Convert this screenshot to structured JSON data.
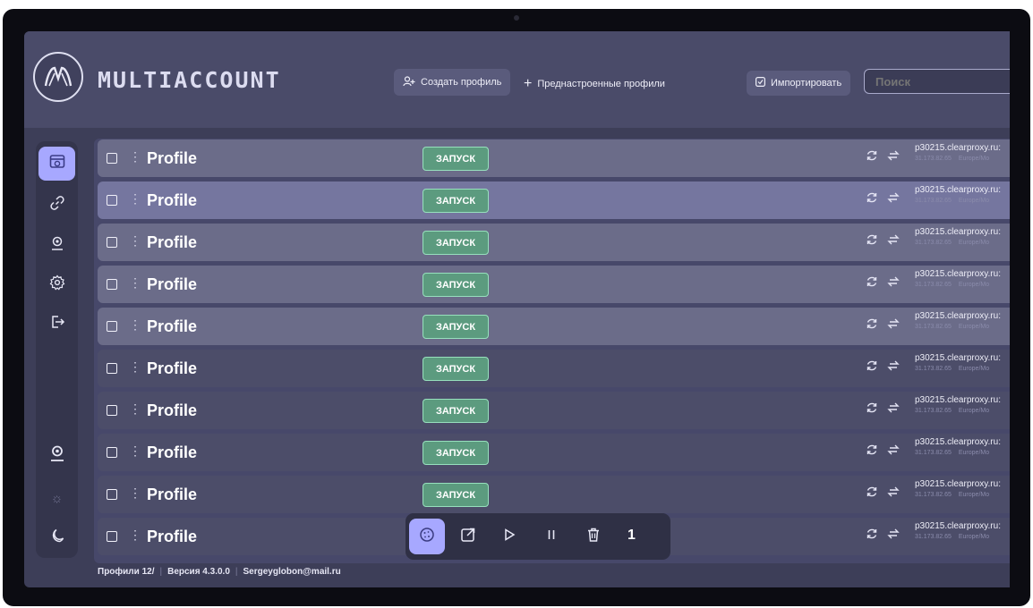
{
  "header": {
    "brand": "MULTIACCOUNT",
    "create_profile": "Создать профиль",
    "preset_profiles": "Преднастроенные профили",
    "import": "Импортировать",
    "search_placeholder": "Поиск"
  },
  "sidebar": {
    "items": [
      {
        "icon": "browser-icon",
        "active": true
      },
      {
        "icon": "link-icon",
        "active": false
      },
      {
        "icon": "user-badge-icon",
        "active": false
      },
      {
        "icon": "gear-icon",
        "active": false
      },
      {
        "icon": "logout-icon",
        "active": false
      },
      {
        "icon": "account-icon",
        "active": false
      },
      {
        "icon": "sun-icon",
        "active": false
      },
      {
        "icon": "moon-icon",
        "active": false
      }
    ]
  },
  "profiles": {
    "rows": [
      {
        "name": "Profile",
        "launch": "ЗАПУСК",
        "proxy": "p30215.clearproxy.ru:",
        "ip": "31.173.82.65",
        "tz": "Europe/Mo"
      },
      {
        "name": "Profile",
        "launch": "ЗАПУСК",
        "proxy": "p30215.clearproxy.ru:",
        "ip": "31.173.82.65",
        "tz": "Europe/Mo"
      },
      {
        "name": "Profile",
        "launch": "ЗАПУСК",
        "proxy": "p30215.clearproxy.ru:",
        "ip": "31.173.82.65",
        "tz": "Europe/Mo"
      },
      {
        "name": "Profile",
        "launch": "ЗАПУСК",
        "proxy": "p30215.clearproxy.ru:",
        "ip": "31.173.82.65",
        "tz": "Europe/Mo"
      },
      {
        "name": "Profile",
        "launch": "ЗАПУСК",
        "proxy": "p30215.clearproxy.ru:",
        "ip": "31.173.82.65",
        "tz": "Europe/Mo"
      },
      {
        "name": "Profile",
        "launch": "ЗАПУСК",
        "proxy": "p30215.clearproxy.ru:",
        "ip": "31.173.82.65",
        "tz": "Europe/Mo"
      },
      {
        "name": "Profile",
        "launch": "ЗАПУСК",
        "proxy": "p30215.clearproxy.ru:",
        "ip": "31.173.82.65",
        "tz": "Europe/Mo"
      },
      {
        "name": "Profile",
        "launch": "ЗАПУСК",
        "proxy": "p30215.clearproxy.ru:",
        "ip": "31.173.82.65",
        "tz": "Europe/Mo"
      },
      {
        "name": "Profile",
        "launch": "ЗАПУСК",
        "proxy": "p30215.clearproxy.ru:",
        "ip": "31.173.82.65",
        "tz": "Europe/Mo"
      },
      {
        "name": "Profile",
        "proxy": "p30215.clearproxy.ru:",
        "ip": "31.173.82.65",
        "tz": "Europe/Mo"
      }
    ]
  },
  "toolbar": {
    "selected_count": "1"
  },
  "footer": {
    "profiles": "Профили 12/",
    "version": "Версия 4.3.0.0",
    "email": "Sergeyglobon@mail.ru"
  }
}
